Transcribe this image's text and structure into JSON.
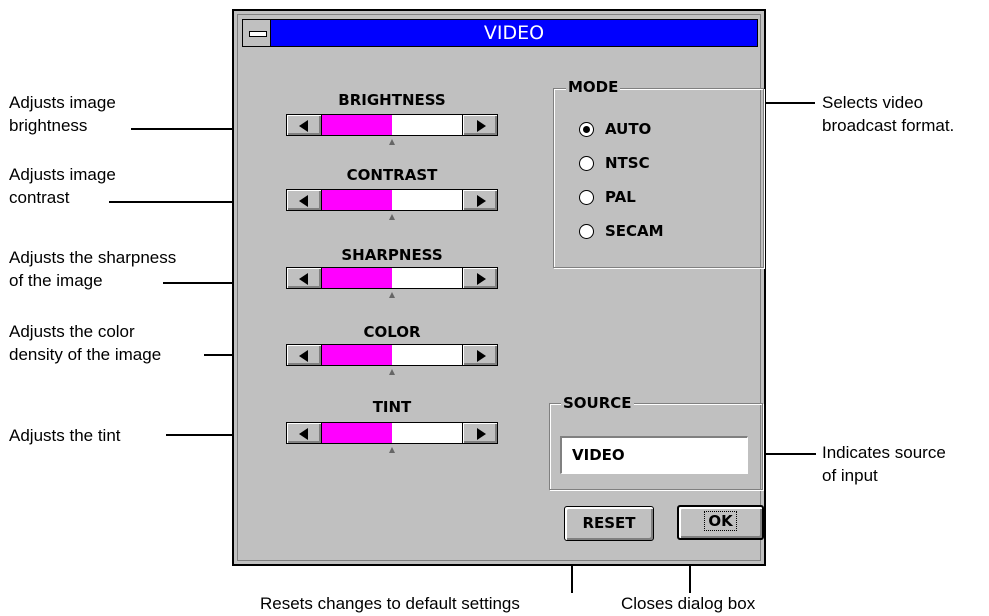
{
  "dialog": {
    "title": "VIDEO"
  },
  "sliders": [
    {
      "label": "BRIGHTNESS",
      "value": 0.5
    },
    {
      "label": "CONTRAST",
      "value": 0.5
    },
    {
      "label": "SHARPNESS",
      "value": 0.5
    },
    {
      "label": "COLOR",
      "value": 0.5
    },
    {
      "label": "TINT",
      "value": 0.5
    }
  ],
  "mode": {
    "title": "MODE",
    "options": [
      "AUTO",
      "NTSC",
      "PAL",
      "SECAM"
    ],
    "selected": "AUTO"
  },
  "source": {
    "title": "SOURCE",
    "value": "VIDEO"
  },
  "buttons": {
    "reset": "RESET",
    "ok": "OK"
  },
  "callouts": {
    "brightness": [
      "Adjusts image",
      "brightness"
    ],
    "contrast": [
      "Adjusts image",
      "contrast"
    ],
    "sharpness": [
      "Adjusts the sharpness",
      "of the image"
    ],
    "color": [
      "Adjusts the color",
      "density of the image"
    ],
    "tint": "Adjusts the tint",
    "mode": [
      "Selects video",
      "broadcast format."
    ],
    "source": [
      "Indicates source",
      "of input"
    ],
    "reset": "Resets changes to default settings",
    "ok": "Closes dialog box"
  },
  "colors": {
    "titlebar": "#0000ff",
    "slider_fill": "#ff00ff",
    "dialog_bg": "#c0c0c0"
  }
}
